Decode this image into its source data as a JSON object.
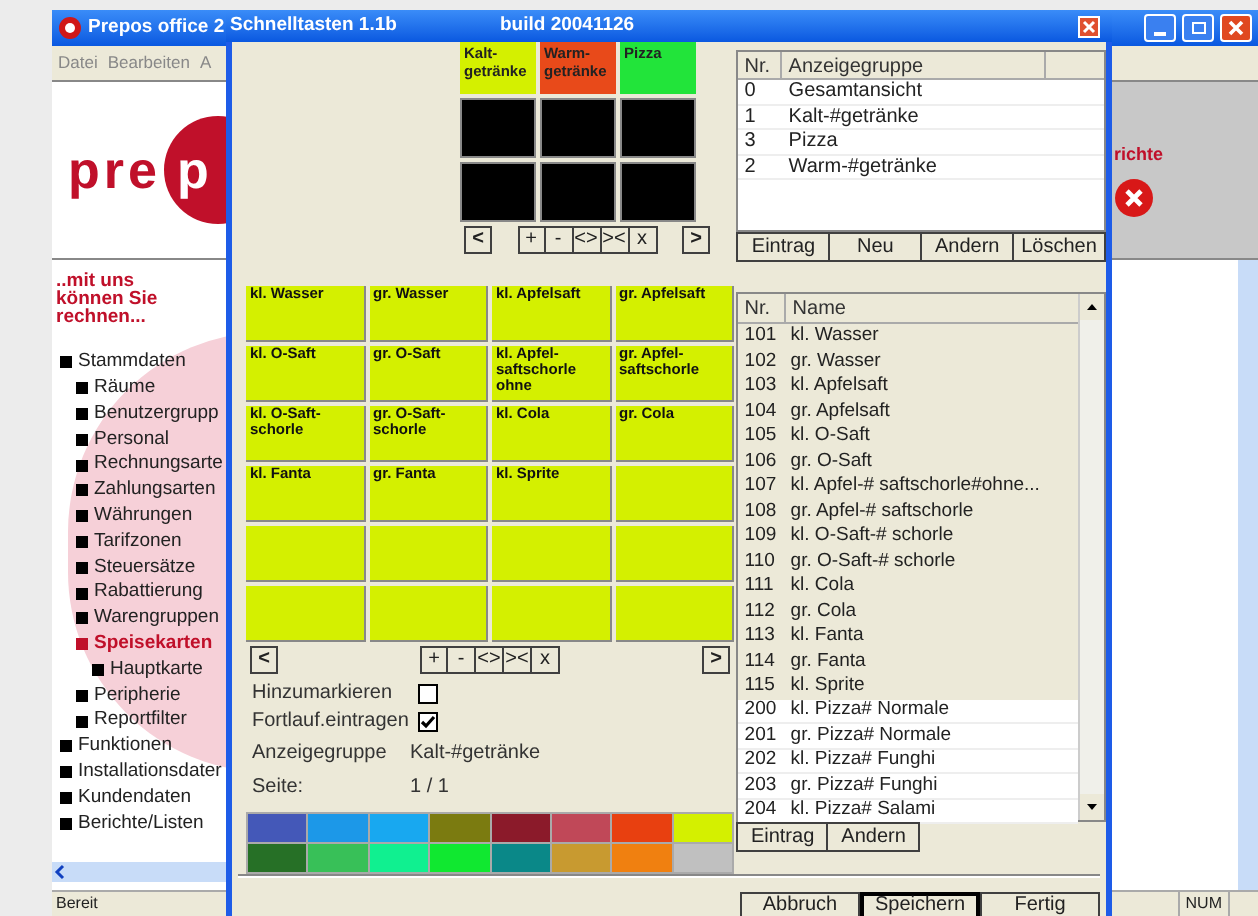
{
  "main_window": {
    "title": "Prepos office 2",
    "menu": [
      "Datei",
      "Bearbeiten",
      "A"
    ],
    "logo": [
      "pre",
      "p"
    ],
    "banner_text": "richte",
    "slogan": "..mit uns können Sie rechnen...",
    "tree": [
      {
        "label": "Stammdaten",
        "selected": false,
        "children": [
          {
            "label": "Räume",
            "selected": false
          },
          {
            "label": "Benutzergrupp",
            "selected": false
          },
          {
            "label": "Personal",
            "selected": false
          },
          {
            "label": "Rechnungsarte",
            "selected": false
          },
          {
            "label": "Zahlungsarten",
            "selected": false
          },
          {
            "label": "Währungen",
            "selected": false
          },
          {
            "label": "Tarifzonen",
            "selected": false
          },
          {
            "label": "Steuersätze",
            "selected": false
          },
          {
            "label": "Rabattierung",
            "selected": false
          },
          {
            "label": "Warengruppen",
            "selected": false
          },
          {
            "label": "Speisekarten",
            "selected": true,
            "children": [
              {
                "label": "Hauptkarte",
                "selected": false
              }
            ]
          },
          {
            "label": "Peripherie",
            "selected": false
          },
          {
            "label": "Reportfilter",
            "selected": false
          }
        ]
      },
      {
        "label": "Funktionen",
        "selected": false
      },
      {
        "label": "Installationsdater",
        "selected": false
      },
      {
        "label": "Kundendaten",
        "selected": false
      },
      {
        "label": "Berichte/Listen",
        "selected": false
      }
    ],
    "status_bar": {
      "text": "Bereit",
      "indicator": "NUM"
    }
  },
  "dialog": {
    "title": "Schnelltasten 1.1b",
    "build": "build 20041126",
    "group_buttons": [
      {
        "label": "Kalt-\ngetränke",
        "color": "#d4f000"
      },
      {
        "label": "Warm-\ngetränke",
        "color": "#e84a1a"
      },
      {
        "label": "Pizza",
        "color": "#22e43a"
      }
    ],
    "group_nav": [
      "<",
      "+",
      "-",
      "<>",
      "><",
      "x",
      ">"
    ],
    "group_table": {
      "columns": [
        "Nr.",
        "Anzeigegruppe"
      ],
      "rows": [
        [
          "0",
          "Gesamtansicht"
        ],
        [
          "1",
          "Kalt-#getränke"
        ],
        [
          "3",
          "Pizza"
        ],
        [
          "2",
          "Warm-#getränke"
        ]
      ],
      "buttons": [
        "Eintrag",
        "Neu",
        "Andern",
        "Löschen"
      ]
    },
    "keys": [
      {
        "kind": "key",
        "label": "kl. Wasser"
      },
      {
        "kind": "key",
        "label": "gr. Wasser"
      },
      {
        "kind": "key",
        "label": "kl. Apfelsaft"
      },
      {
        "kind": "key",
        "label": "gr. Apfelsaft"
      },
      {
        "kind": "key",
        "label": "kl. O-Saft"
      },
      {
        "kind": "key",
        "label": "gr. O-Saft"
      },
      {
        "kind": "key",
        "label": "kl. Apfel-\nsaftschorle\nohne"
      },
      {
        "kind": "key",
        "label": "gr. Apfel-\nsaftschorle"
      },
      {
        "kind": "key",
        "label": "kl. O-Saft-\nschorle"
      },
      {
        "kind": "key",
        "label": "gr. O-Saft-\nschorle"
      },
      {
        "kind": "key",
        "label": "kl. Cola"
      },
      {
        "kind": "key",
        "label": "gr. Cola"
      },
      {
        "kind": "key",
        "label": "kl. Fanta"
      },
      {
        "kind": "key",
        "label": "gr. Fanta"
      },
      {
        "kind": "key",
        "label": "kl. Sprite"
      },
      {
        "kind": "empty"
      },
      {
        "kind": "empty"
      },
      {
        "kind": "empty"
      },
      {
        "kind": "empty"
      },
      {
        "kind": "empty"
      },
      {
        "kind": "empty"
      },
      {
        "kind": "empty"
      },
      {
        "kind": "empty"
      },
      {
        "kind": "empty"
      }
    ],
    "key_nav": [
      "<",
      "+",
      "-",
      "<>",
      "><",
      "x",
      ">"
    ],
    "options": [
      {
        "label": "Hinzumarkieren",
        "checked": false
      },
      {
        "label": "Fortlauf.eintragen",
        "checked": true
      }
    ],
    "info": [
      {
        "label": "Anzeigegruppe",
        "value": "Kalt-#getränke"
      },
      {
        "label": "Seite:",
        "value": "1 / 1"
      }
    ],
    "palette": [
      {
        "color": "#4458b8"
      },
      {
        "color": "#1c98e8"
      },
      {
        "color": "#18a8f0"
      },
      {
        "color": "#7b7b10"
      },
      {
        "color": "#8b1a2a"
      },
      {
        "color": "#c04858"
      },
      {
        "color": "#e84010"
      },
      {
        "color": "#d4f000"
      },
      {
        "color": "#267026"
      },
      {
        "color": "#38c058"
      },
      {
        "color": "#10f090"
      },
      {
        "color": "#10e830"
      },
      {
        "color": "#0a8888"
      },
      {
        "color": "#c89a30"
      },
      {
        "color": "#f08010"
      },
      {
        "color": "#c0c0c0"
      }
    ],
    "article_table": {
      "columns": [
        "Nr.",
        "Name"
      ],
      "rows": [
        {
          "nr": "101",
          "name": "kl. Wasser",
          "placed": true
        },
        {
          "nr": "102",
          "name": "gr. Wasser",
          "placed": true
        },
        {
          "nr": "103",
          "name": "kl. Apfelsaft",
          "placed": true
        },
        {
          "nr": "104",
          "name": "gr. Apfelsaft",
          "placed": true
        },
        {
          "nr": "105",
          "name": "kl. O-Saft",
          "placed": true
        },
        {
          "nr": "106",
          "name": "gr. O-Saft",
          "placed": true
        },
        {
          "nr": "107",
          "name": "kl. Apfel-# saftschorle#ohne...",
          "placed": true
        },
        {
          "nr": "108",
          "name": "gr. Apfel-# saftschorle",
          "placed": true
        },
        {
          "nr": "109",
          "name": "kl. O-Saft-# schorle",
          "placed": true
        },
        {
          "nr": "110",
          "name": "gr. O-Saft-# schorle",
          "placed": true
        },
        {
          "nr": "111",
          "name": "kl. Cola",
          "placed": true
        },
        {
          "nr": "112",
          "name": "gr. Cola",
          "placed": true
        },
        {
          "nr": "113",
          "name": "kl. Fanta",
          "placed": true
        },
        {
          "nr": "114",
          "name": "gr. Fanta",
          "placed": true
        },
        {
          "nr": "115",
          "name": "kl. Sprite",
          "placed": true
        },
        {
          "nr": "200",
          "name": "kl. Pizza# Normale",
          "placed": false
        },
        {
          "nr": "201",
          "name": "gr. Pizza# Normale",
          "placed": false
        },
        {
          "nr": "202",
          "name": "kl. Pizza# Funghi",
          "placed": false
        },
        {
          "nr": "203",
          "name": "gr. Pizza# Funghi",
          "placed": false
        },
        {
          "nr": "204",
          "name": "kl. Pizza# Salami",
          "placed": false
        }
      ],
      "buttons": [
        "Eintrag",
        "Andern"
      ]
    },
    "footer_buttons": [
      {
        "label": "Abbruch",
        "default": false
      },
      {
        "label": "Speichern",
        "default": true
      },
      {
        "label": "Fertig",
        "default": false
      }
    ]
  }
}
